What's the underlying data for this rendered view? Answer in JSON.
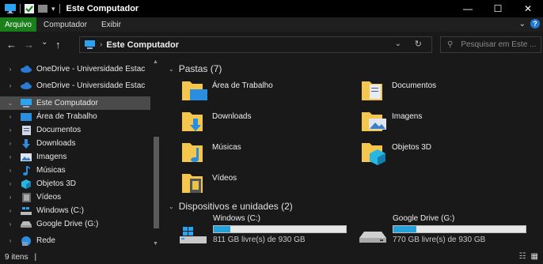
{
  "window": {
    "title": "Este Computador",
    "controls": {
      "minimize": "—",
      "maximize": "☐",
      "close": "✕"
    }
  },
  "ribbon": {
    "tabs": [
      {
        "label": "Arquivo",
        "active": true
      },
      {
        "label": "Computador"
      },
      {
        "label": "Exibir"
      }
    ]
  },
  "navigation": {
    "back": "←",
    "forward": "→",
    "recent": "⌄",
    "up": "↑",
    "address": "Este Computador",
    "search_placeholder": "Pesquisar em Este ..."
  },
  "sidebar": {
    "items": [
      {
        "label": "OneDrive - Universidade Estac",
        "icon": "cloud-icon",
        "expanded": false
      },
      {
        "label": "OneDrive - Universidade Estac",
        "icon": "cloud-icon",
        "expanded": false
      },
      {
        "label": "Este Computador",
        "icon": "computer-icon",
        "expanded": true,
        "selected": true
      },
      {
        "label": "Área de Trabalho",
        "icon": "desktop-icon",
        "child": true
      },
      {
        "label": "Documentos",
        "icon": "documents-icon",
        "child": true
      },
      {
        "label": "Downloads",
        "icon": "downloads-icon",
        "child": true
      },
      {
        "label": "Imagens",
        "icon": "images-icon",
        "child": true
      },
      {
        "label": "Músicas",
        "icon": "music-icon",
        "child": true
      },
      {
        "label": "Objetos 3D",
        "icon": "objects-3d-icon",
        "child": true
      },
      {
        "label": "Vídeos",
        "icon": "videos-icon",
        "child": true
      },
      {
        "label": "Windows (C:)",
        "icon": "windows-drive-icon",
        "child": true
      },
      {
        "label": "Google Drive (G:)",
        "icon": "drive-icon",
        "child": true
      },
      {
        "label": "Rede",
        "icon": "network-icon"
      }
    ]
  },
  "content": {
    "folders_group": "Pastas (7)",
    "folders": [
      {
        "label": "Área de Trabalho",
        "icon": "desktop-folder-icon"
      },
      {
        "label": "Documentos",
        "icon": "documents-folder-icon"
      },
      {
        "label": "Downloads",
        "icon": "downloads-folder-icon"
      },
      {
        "label": "Imagens",
        "icon": "images-folder-icon"
      },
      {
        "label": "Músicas",
        "icon": "music-folder-icon"
      },
      {
        "label": "Objetos 3D",
        "icon": "objects-3d-folder-icon"
      },
      {
        "label": "Vídeos",
        "icon": "videos-folder-icon"
      }
    ],
    "drives_group": "Dispositivos e unidades (2)",
    "drives": [
      {
        "label": "Windows (C:)",
        "free": "811 GB livre(s) de 930 GB",
        "used_fraction": 0.128,
        "icon": "windows-drive-icon"
      },
      {
        "label": "Google Drive (G:)",
        "free": "770 GB livre(s) de 930 GB",
        "used_fraction": 0.172,
        "icon": "drive-icon"
      }
    ]
  },
  "status": {
    "items": "9 itens",
    "cursor": "|"
  },
  "colors": {
    "accent": "#26a0da",
    "ribbon_file": "#1a7f1a",
    "folder_yellow": "#f4c64d",
    "background": "#191919"
  }
}
